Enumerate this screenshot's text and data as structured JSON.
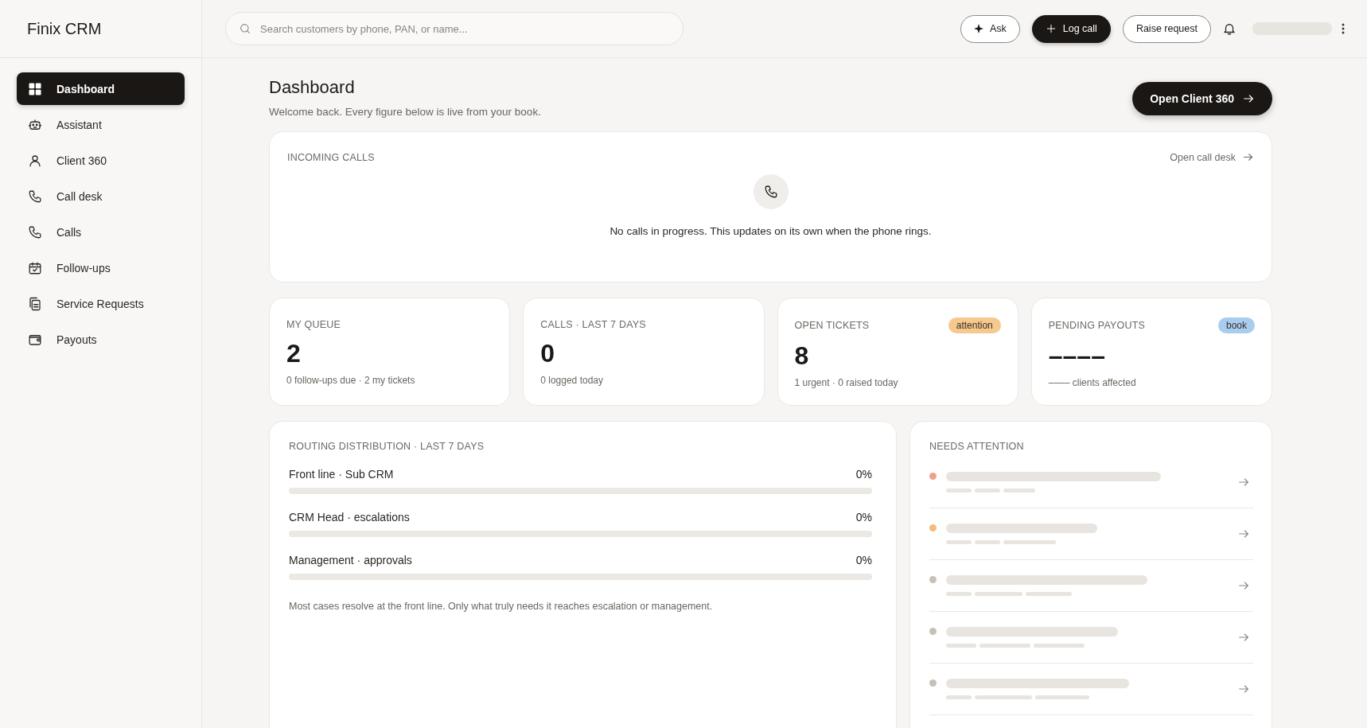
{
  "app": {
    "name": "Finix CRM"
  },
  "sidebar": {
    "items": [
      {
        "label": "Dashboard",
        "selected": true
      },
      {
        "label": "Assistant",
        "selected": false
      },
      {
        "label": "Client 360",
        "selected": false
      },
      {
        "label": "Call desk",
        "selected": false
      },
      {
        "label": "Calls",
        "selected": false
      },
      {
        "label": "Follow-ups",
        "selected": false
      },
      {
        "label": "Service Requests",
        "selected": false
      },
      {
        "label": "Payouts",
        "selected": false
      }
    ]
  },
  "header": {
    "search": {
      "placeholder": "Search customers by phone, PAN, or name..."
    },
    "buttons": [
      {
        "label": "Ask",
        "kind": "ask"
      },
      {
        "label": "Log call",
        "kind": "primary"
      },
      {
        "label": "Raise request",
        "kind": "plain"
      }
    ]
  },
  "page": {
    "title": "Dashboard",
    "subtitle": "Welcome back. Every figure below is live from your book.",
    "action": "Open Client 360"
  },
  "incoming_calls": {
    "title": "INCOMING CALLS",
    "link": "Open call desk",
    "message": "No calls in progress. This updates on its own when the phone rings."
  },
  "stats": [
    {
      "title": "MY QUEUE",
      "value": "2",
      "detail": "0 follow-ups due · 2 my tickets"
    },
    {
      "title": "CALLS · LAST 7 DAYS",
      "value": "0",
      "detail": "0 logged today"
    },
    {
      "title": "OPEN TICKETS",
      "value": "8",
      "detail": "1 urgent · 0 raised today",
      "badge": {
        "text": "attention",
        "color": "#f6c98e"
      }
    },
    {
      "title": "PENDING PAYOUTS",
      "value": "––––",
      "detail": "–––– clients affected",
      "badge": {
        "text": "book",
        "color": "#a9cdef"
      }
    }
  ],
  "routing": {
    "title": "ROUTING DISTRIBUTION · LAST 7 DAYS",
    "rows": [
      {
        "label": "Front line · Sub CRM",
        "reading": "0%",
        "level": 0
      },
      {
        "label": "CRM Head · escalations",
        "reading": "0%",
        "level": 0
      },
      {
        "label": "Management · approvals",
        "reading": "0%",
        "level": 0
      }
    ],
    "note": "Most cases resolve at the front line. Only what truly needs it reaches escalation or management."
  },
  "needs_attention": {
    "title": "NEEDS ATTENTION",
    "items": [
      {
        "color": "#eea28e"
      },
      {
        "color": "#f1bd7a"
      },
      {
        "color": "#c7c0b9"
      },
      {
        "color": "#c7c0b9"
      },
      {
        "color": "#c7c0b9"
      }
    ]
  }
}
